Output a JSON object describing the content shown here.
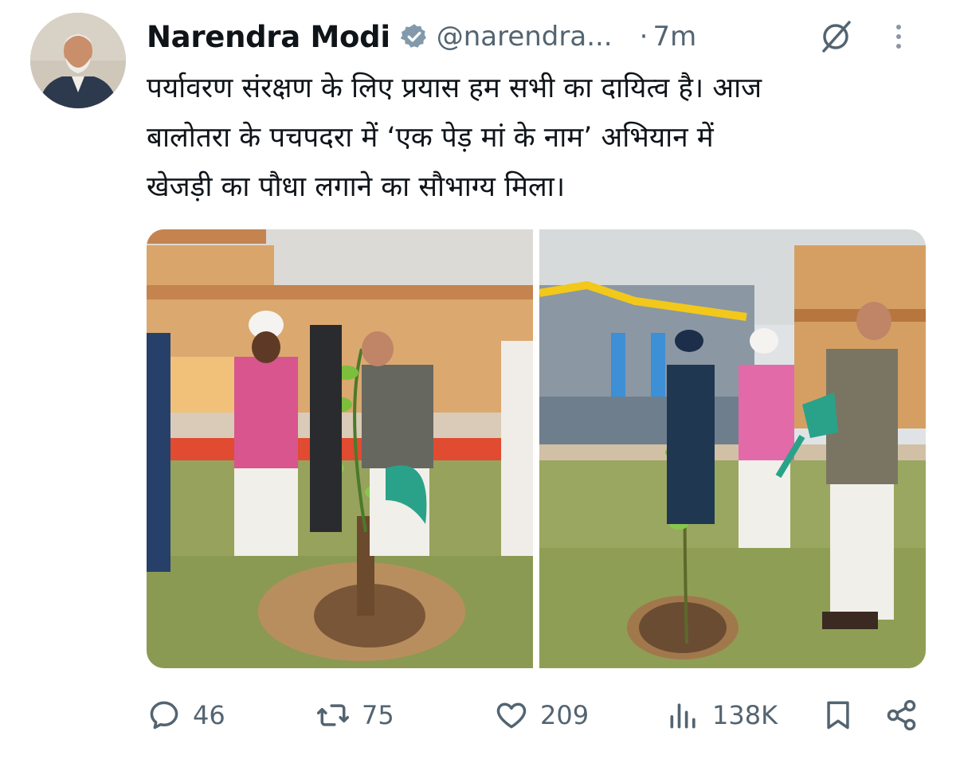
{
  "tweet": {
    "author_name": "Narendra Modi",
    "handle": "@narendra...",
    "separator": "·",
    "time": "7m",
    "text": "पर्यावरण संरक्षण के लिए प्रयास हम सभी का दायित्व है। आज\nबालोतरा के पचपदरा में ‘एक पेड़ मां के नाम’ अभियान में\nखेजड़ी का पौधा लगाने का सौभाग्य मिला।"
  },
  "metrics": {
    "replies": "46",
    "reposts": "75",
    "likes": "209",
    "views": "138K"
  },
  "icons": {
    "verified": "verified-badge-icon",
    "grok": "grok-icon",
    "more": "more-vertical-icon",
    "reply": "reply-icon",
    "repost": "repost-icon",
    "like": "like-icon",
    "views": "views-icon",
    "bookmark": "bookmark-icon",
    "share": "share-icon"
  },
  "colors": {
    "text": "#0f1419",
    "secondary": "#536471",
    "verified": "#829aab"
  }
}
